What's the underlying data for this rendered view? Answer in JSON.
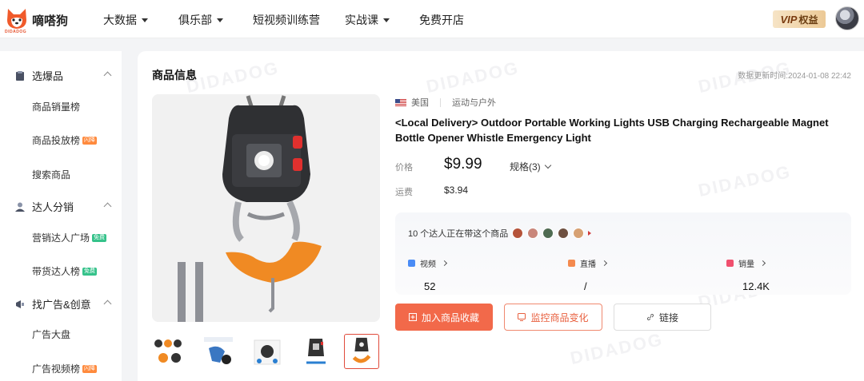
{
  "header": {
    "brand_name": "嘀嗒狗",
    "brand_sub": "DIDADOG",
    "nav": [
      {
        "label": "大数据",
        "dropdown": true
      },
      {
        "label": "俱乐部",
        "dropdown": true
      },
      {
        "label": "短视频训练营",
        "dropdown": false
      },
      {
        "label": "实战课",
        "dropdown": true
      },
      {
        "label": "免费开店",
        "dropdown": false
      }
    ],
    "vip_mark": "VIP",
    "vip_label": "权益"
  },
  "sidebar": {
    "groups": [
      {
        "label": "选爆品",
        "icon": "box-icon",
        "items": [
          {
            "label": "商品销量榜",
            "badge": ""
          },
          {
            "label": "商品投放榜",
            "badge": "闪降"
          },
          {
            "label": "搜索商品",
            "badge": ""
          }
        ]
      },
      {
        "label": "达人分销",
        "icon": "person-icon",
        "items": [
          {
            "label": "营销达人广场",
            "badge": "免费"
          },
          {
            "label": "带货达人榜",
            "badge": "免费"
          }
        ]
      },
      {
        "label": "找广告&创意",
        "icon": "megaphone-icon",
        "items": [
          {
            "label": "广告大盘",
            "badge": ""
          },
          {
            "label": "广告视频榜",
            "badge": "闪降"
          }
        ]
      }
    ]
  },
  "product": {
    "section_title": "商品信息",
    "update_time": "数据更新时间:2024-01-08 22:42",
    "country": "美国",
    "category": "运动与户外",
    "title": "<Local  Delivery> Outdoor Portable Working Lights USB Charging Rechargeable Magnet Bottle Opener Whistle Emergency Light",
    "price_label": "价格",
    "price": "$9.99",
    "spec_label": "规格(3)",
    "shipping_label": "运费",
    "shipping": "$3.94",
    "influencer_text": "10 个达人正在带这个商品",
    "stats": [
      {
        "label": "视频",
        "value": "52",
        "color": "#4a8cf6"
      },
      {
        "label": "直播",
        "value": "/",
        "color": "#f48a4e"
      },
      {
        "label": "销量",
        "value": "12.4K",
        "color": "#f0506e"
      }
    ],
    "buttons": {
      "favorite": "加入商品收藏",
      "monitor": "监控商品变化",
      "link": "链接"
    }
  },
  "colors": {
    "accent": "#f2694a",
    "brand": "#e6532f"
  }
}
